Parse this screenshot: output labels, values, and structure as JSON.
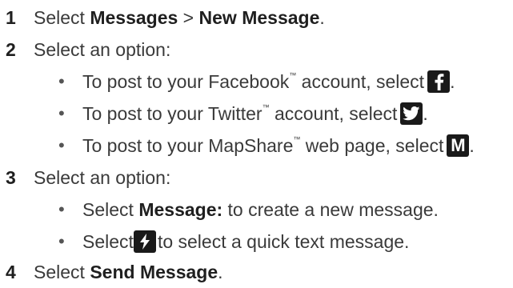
{
  "step1": {
    "number": "1",
    "prefix": "Select ",
    "menu": "Messages",
    "sep": " > ",
    "item": "New Message",
    "end": "."
  },
  "step2": {
    "number": "2",
    "text": "Select an option:",
    "bullets": [
      {
        "pre": "To post to your Facebook",
        "tm": "™",
        "post": " account, select ",
        "icon": "facebook-icon",
        "end": "."
      },
      {
        "pre": "To post to your Twitter",
        "tm": "™",
        "post": " account, select ",
        "icon": "twitter-icon",
        "end": "."
      },
      {
        "pre": "To post to your MapShare",
        "tm": "™",
        "post": " web page, select ",
        "icon": "mapshare-icon",
        "icon_letter": "M",
        "end": "."
      }
    ]
  },
  "step3": {
    "number": "3",
    "text": "Select an option:",
    "bullets": [
      {
        "pre": "Select ",
        "bold": "Message:",
        "post": " to create a new message."
      },
      {
        "pre": "Select ",
        "icon": "quick-text-icon",
        "post": " to select a quick text message."
      }
    ]
  },
  "step4": {
    "number": "4",
    "prefix": "Select ",
    "bold": "Send Message",
    "end": "."
  },
  "bullet_char": "•"
}
